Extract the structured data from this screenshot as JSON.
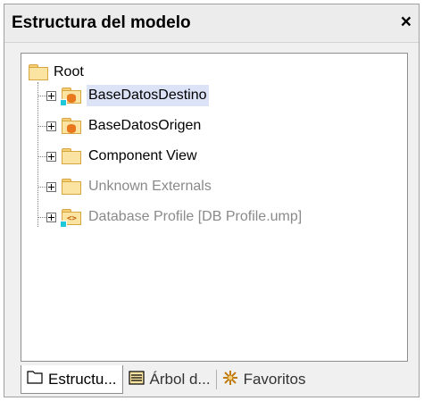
{
  "panel": {
    "title": "Estructura del modelo",
    "close_glyph": "×"
  },
  "tree": {
    "root_label": "Root",
    "items": [
      {
        "label": "BaseDatosDestino",
        "icon": "database-folder-icon",
        "selected": true,
        "dim": false
      },
      {
        "label": "BaseDatosOrigen",
        "icon": "database-folder-icon",
        "selected": false,
        "dim": false
      },
      {
        "label": "Component View",
        "icon": "folder-icon",
        "selected": false,
        "dim": false
      },
      {
        "label": "Unknown Externals",
        "icon": "folder-icon",
        "selected": false,
        "dim": true
      },
      {
        "label": "Database Profile [DB Profile.ump]",
        "icon": "linked-code-folder-icon",
        "selected": false,
        "dim": true
      }
    ]
  },
  "tabs": [
    {
      "label": "Estructu...",
      "icon": "folder-icon",
      "active": true
    },
    {
      "label": "Árbol d...",
      "icon": "tree-list-icon",
      "active": false
    },
    {
      "label": "Favoritos",
      "icon": "star-icon",
      "active": false
    }
  ],
  "colors": {
    "selection": "#dde3f7",
    "folder": "#fbe4a2",
    "database": "#e8771d",
    "link": "#1ec8d8"
  }
}
